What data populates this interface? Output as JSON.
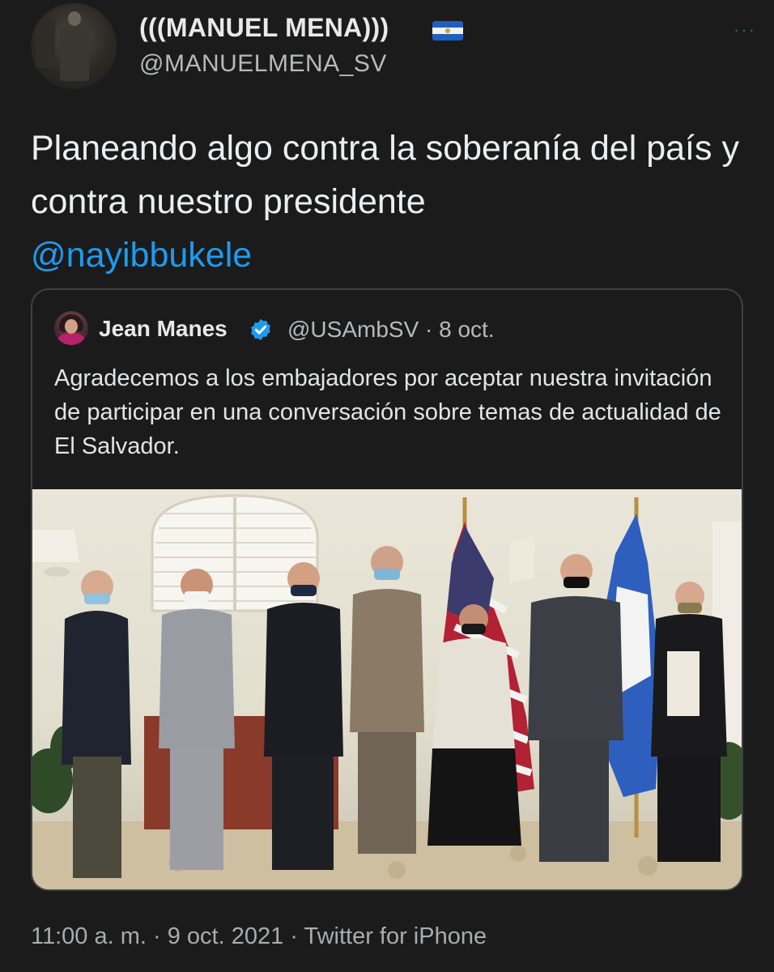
{
  "author": {
    "display_name": "(((MANUEL MENA)))",
    "handle": "@MANUELMENA_SV",
    "flag_icon": "el-salvador-flag-icon",
    "more_label": "···"
  },
  "tweet": {
    "text_plain": "Planeando algo contra la soberanía del país y contra nuestro presidente",
    "mention": "@nayibbukele"
  },
  "quoted": {
    "name": "Jean Manes",
    "verified_icon": "verified-badge-icon",
    "meta": "@USAmbSV · 8 oct.",
    "text": "Agradecemos a los embajadores por aceptar nuestra invitación de participar en una conversación sobre temas de actualidad de El Salvador."
  },
  "footer": {
    "text": "11:00 a. m. · 9 oct. 2021 · Twitter for iPhone"
  },
  "colors": {
    "background": "#1b1b1b",
    "mention": "#1d9bf0",
    "verified": "#1d9bf0",
    "muted": "#b7b9bb"
  }
}
